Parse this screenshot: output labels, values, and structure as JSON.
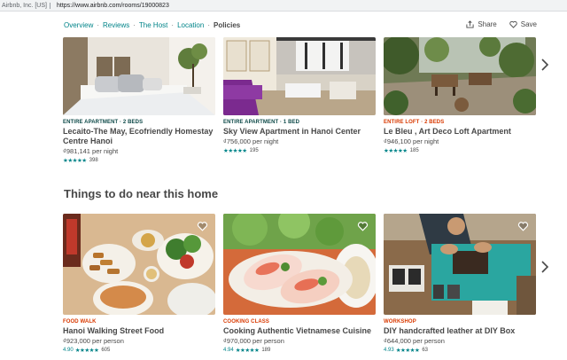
{
  "browser": {
    "site_label": "Airbnb, Inc. [US]",
    "url": "https://www.airbnb.com/rooms/19000823"
  },
  "subnav": {
    "overview": "Overview",
    "reviews": "Reviews",
    "host": "The Host",
    "location": "Location",
    "policies": "Policies",
    "separator": "·"
  },
  "actions": {
    "share": "Share",
    "save": "Save"
  },
  "listings": [
    {
      "kicker": "ENTIRE APARTMENT · 2 BEDS",
      "title": "Lecaito-The May, Ecofriendly Homestay Centre Hanoi",
      "price": "₫981,141 per night",
      "stars": "★★★★★",
      "reviews": "398",
      "kicker_color": "teal"
    },
    {
      "kicker": "ENTIRE APARTMENT · 1 BED",
      "title": "Sky View Apartment in Hanoi Center",
      "price": "₫756,000 per night",
      "stars": "★★★★★",
      "reviews": "195",
      "kicker_color": "teal"
    },
    {
      "kicker": "ENTIRE LOFT · 2 BEDS",
      "title": "Le Bleu , Art Deco Loft Apartment",
      "price": "₫946,100 per night",
      "stars": "★★★★★",
      "reviews": "185",
      "kicker_color": "red"
    }
  ],
  "section_title": "Things to do near this home",
  "experiences": [
    {
      "kicker": "FOOD WALK",
      "title": "Hanoi Walking Street Food",
      "price": "₫923,000 per person",
      "stars": "★★★★★",
      "rating": "4.90",
      "reviews": "605"
    },
    {
      "kicker": "COOKING CLASS",
      "title": "Cooking Authentic Vietnamese Cuisine",
      "price": "₫970,000 per person",
      "stars": "★★★★★",
      "rating": "4.94",
      "reviews": "189"
    },
    {
      "kicker": "WORKSHOP",
      "title": "DIY handcrafted leather at DIY Box",
      "price": "₫644,000 per person",
      "stars": "★★★★★",
      "rating": "4.93",
      "reviews": "63"
    }
  ],
  "icons": {
    "share": "share-icon",
    "save": "heart-icon",
    "next": "chevron-right-icon"
  },
  "colors": {
    "accent_teal": "#008489",
    "kicker_teal": "#0d4948",
    "kicker_red": "#d93900",
    "text": "#484848"
  }
}
